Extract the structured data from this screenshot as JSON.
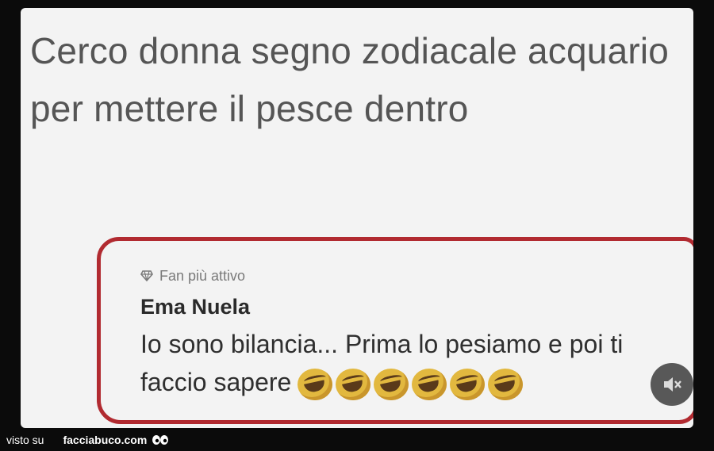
{
  "post": {
    "text": "Cerco donna segno zodiacale acquario per mettere il pesce dentro"
  },
  "comment": {
    "badge_label": "Fan più attivo",
    "badge_icon": "diamond-icon",
    "author": "Ema Nuela",
    "text": "Io sono bilancia... Prima lo pesiamo e poi ti faccio sapere",
    "emoji_count": 6,
    "emoji_icon": "laughing-emoji-icon",
    "highlight_color": "#b12a30"
  },
  "overlay": {
    "mute_icon": "mute-speaker-icon"
  },
  "watermark": {
    "prefix": "visto su",
    "site": "facciabuco.com",
    "icon": "eyes-icon"
  }
}
